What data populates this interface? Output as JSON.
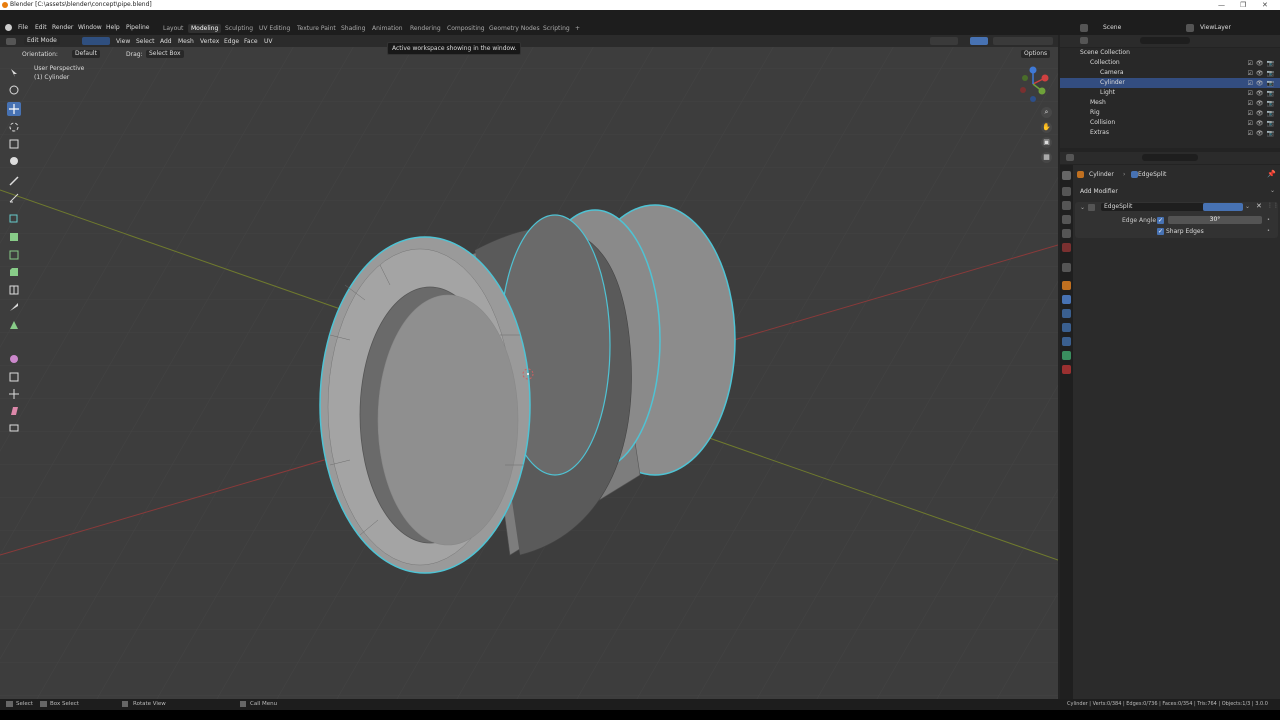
{
  "app": {
    "window_title": "Blender [C:\\assets\\blender\\concept\\pipe.blend]",
    "window_controls": [
      "—",
      "❐",
      "✕"
    ]
  },
  "menu": {
    "items": [
      "File",
      "Edit",
      "Render",
      "Window",
      "Help",
      "Pipeline"
    ]
  },
  "workspaces": {
    "tabs": [
      "Layout",
      "Modeling",
      "Sculpting",
      "UV Editing",
      "Texture Paint",
      "Shading",
      "Animation",
      "Rendering",
      "Compositing",
      "Geometry Nodes",
      "Scripting"
    ],
    "active": "Modeling",
    "add": "+"
  },
  "scene": {
    "label": "Scene",
    "view_layer": "ViewLayer"
  },
  "viewport_header": {
    "mode": "Edit Mode",
    "menus": [
      "View",
      "Select",
      "Add",
      "Mesh",
      "Vertex",
      "Edge",
      "Face",
      "UV"
    ],
    "tooltip": "Active workspace showing in the window.",
    "options": "Options"
  },
  "tool_settings": {
    "orientation_label": "Orientation:",
    "orientation_value": "Default",
    "drag_label": "Drag:",
    "drag_value": "Select Box"
  },
  "viewport_info": {
    "perspective": "User Perspective",
    "object": "(1) Cylinder"
  },
  "gizmo": {
    "x": "X",
    "y": "Y",
    "z": "Z"
  },
  "outliner": {
    "root": "Scene Collection",
    "rows": [
      {
        "label": "Collection"
      },
      {
        "label": "Camera"
      },
      {
        "label": "Cylinder"
      },
      {
        "label": "Light"
      },
      {
        "label": "Mesh"
      },
      {
        "label": "Rig"
      },
      {
        "label": "Collision"
      },
      {
        "label": "Extras"
      }
    ]
  },
  "properties": {
    "breadcrumb_object": "Cylinder",
    "breadcrumb_modifier": "EdgeSplit",
    "add_modifier": "Add Modifier",
    "modifier_name": "EdgeSplit",
    "edge_angle_label": "Edge Angle",
    "edge_angle_value": "30°",
    "sharp_edges_label": "Sharp Edges"
  },
  "statusbar": {
    "select": "Select",
    "box_select": "Box Select",
    "rotate_view": "Rotate View",
    "call_menu": "Call Menu",
    "stats": "Cylinder | Verts:0/384 | Edges:0/736 | Faces:0/354 | Tris:764 | Objects:1/3 | 3.0.0"
  },
  "colors": {
    "accent": "#4772b3",
    "edge_highlight": "#4fc3d4",
    "mesh_fill": "#9a9a9a",
    "viewport_bg": "#3d3d3d"
  }
}
